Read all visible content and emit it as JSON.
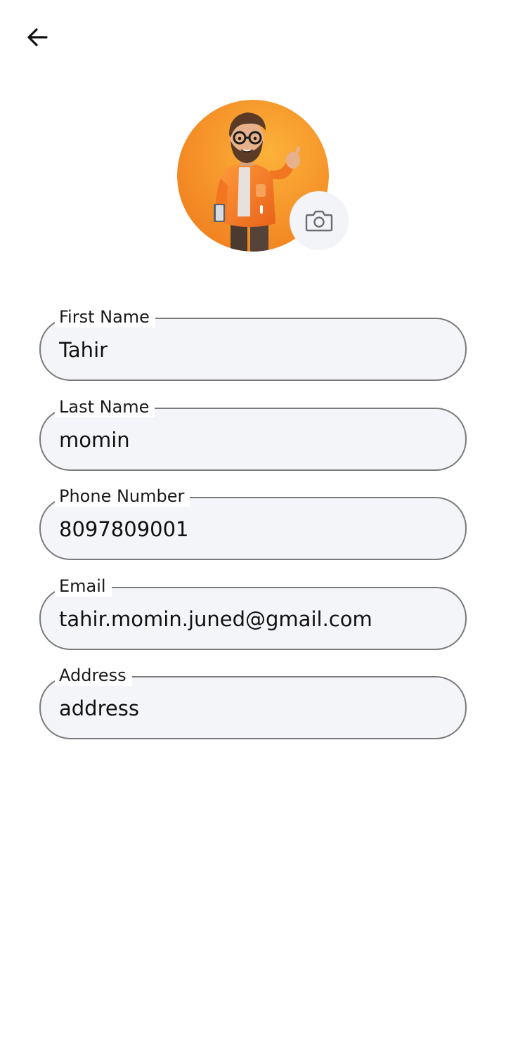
{
  "header": {
    "back_icon": "arrow-left-icon"
  },
  "profile": {
    "avatar_colors": {
      "orange_light": "#fcb23a",
      "orange_dark": "#f07e1e"
    },
    "camera_icon": "camera-icon"
  },
  "form": {
    "fields": [
      {
        "label": "First Name",
        "value": "Tahir"
      },
      {
        "label": "Last Name",
        "value": "momin"
      },
      {
        "label": "Phone Number",
        "value": "8097809001"
      },
      {
        "label": "Email",
        "value": "tahir.momin.juned@gmail.com"
      },
      {
        "label": "Address",
        "value": "address"
      }
    ]
  }
}
